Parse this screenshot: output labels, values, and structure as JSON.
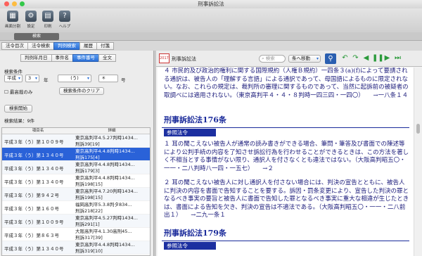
{
  "window": {
    "title": "刑事訴訟法"
  },
  "toolbar": {
    "items": [
      {
        "label": "画面分割",
        "icon": "split-icon"
      },
      {
        "label": "設定",
        "icon": "gear-icon"
      },
      {
        "label": "印刷",
        "icon": "printer-icon"
      },
      {
        "label": "ヘルプ",
        "icon": "help-icon"
      }
    ]
  },
  "segment": {
    "selected": "検索"
  },
  "left": {
    "tabs1": [
      "法令目次",
      "法令検索",
      "判例検索",
      "履歴",
      "付箋"
    ],
    "tabs1_selected": 2,
    "tabs2": [
      "判例年月日",
      "事件名",
      "事件番号",
      "全文"
    ],
    "tabs2_selected": 2,
    "search_label": "検索条件",
    "era": "平成",
    "year": "3",
    "year_unit": "年",
    "case_type": "(う)",
    "number": "＊",
    "number_unit": "号",
    "checkbox_label": "最高裁のみ",
    "clear_button": "検索条件のクリア",
    "start_button": "検索開始",
    "result_label": "検索結果：9件",
    "columns": [
      "項目名",
      "詳細"
    ],
    "rows": [
      {
        "item": "平成３年（う）第１００９号",
        "line1": "東京高判平4.5.27判時1434...",
        "line2": "刑訴39[19]"
      },
      {
        "item": "平成３年（う）第１３４０号",
        "line1": "東京高判平4.4.8判時1434...",
        "line2": "刑訴175[4]"
      },
      {
        "item": "平成３年（う）第１３４０号",
        "line1": "東京高判平4.4.8判時1434...",
        "line2": "刑訴179[3]"
      },
      {
        "item": "平成３年（う）第１３４０号",
        "line1": "東京高判平4.4.8判時1434...",
        "line2": "刑訴198[15]"
      },
      {
        "item": "平成３年（う）第９４２号",
        "line1": "東京高判平4.7.20判時1434...",
        "line2": "刑訴198[15]"
      },
      {
        "item": "平成３年（う）第１６０号",
        "line1": "福岡高判平5.3.8判タ834...",
        "line2": "刑訴218[22]"
      },
      {
        "item": "平成３年（う）第１００９号",
        "line1": "東京高判平4.5.27判時1434...",
        "line2": "刑訴291[1]"
      },
      {
        "item": "平成３年（う）第８６３号",
        "line1": "大阪高判平4.1.30高刑45...",
        "line2": "刑訴317[39]"
      },
      {
        "item": "平成３年（う）第１３４０号",
        "line1": "東京高判平4.4.8判時1434...",
        "line2": "刑訴319[10]"
      }
    ],
    "selected_row": 1
  },
  "right": {
    "badge": "2017",
    "law_title": "刑事訴訟法",
    "search_placeholder": "検索",
    "jump_button": "条へ移動",
    "para_top": "４ 市民的及び政治的権利に関する国際規約（人権Ｂ規約）一四条３(a)(f)によって要請される通訳は、被告人の「理解する言語」による通訳であって、母国語によるものに限定されない。なお、これらの規定は、裁判所の審理に関するものであって、当然に起訴前の被疑者の取調べには適用されない。（東京高判平４・４・８判時一四三四・一四〇）　　→一八条１４",
    "heading1": "刑事訴訟法176条",
    "ref_label": "参照法令",
    "para1": "１ 耳の聞こえない被告人が通常の読み書きができる場合、筆問・筆答及び書面での陳述等により公判手続の内容を了知させ訴訟行為を行わせることができるときは、この方法を著しく不相当とする事情がない限り、通訳人を付さなくとも違法ではない。（大阪高判昭五〇・一一・二八判時八一四・一五七）　　→２",
    "para2": "２ 耳の聞こえない被告人に対し通訳人を付さない場合には、判決の宣告とともに、被告人に判決の内容を書面で告知することを要する。訴因・罰条変更により、宣告した判決の罪となるべき事実の要旨と被告人に書面で告知した罪となるべき事実に重大な相違が生じたときは、書面による告知を欠き、判決の宣告は不適法である。（大阪高判昭五〇・一一・二八前出１）　　→二九一条１",
    "heading2": "刑事訴訟法179条"
  }
}
